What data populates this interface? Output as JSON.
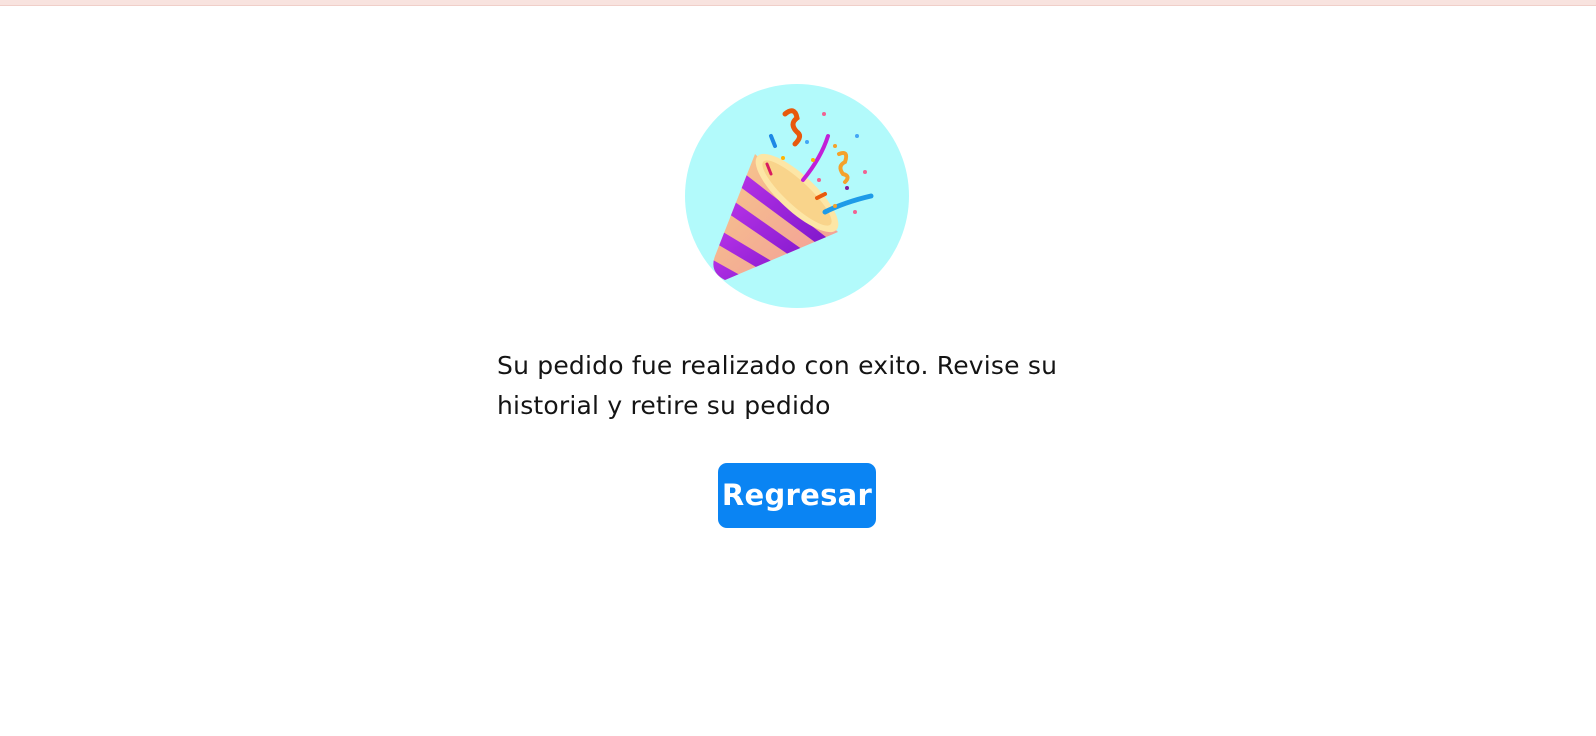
{
  "page": {
    "background": "#ffffff",
    "topbar_color": "#f8e3df"
  },
  "success": {
    "icon": "party-popper-icon",
    "icon_circle_color": "#b2fafb",
    "message_line1": "Su pedido fue realizado con exito. Revise su",
    "message_line2": "historial y retire su pedido",
    "button_label": "Regresar",
    "button_color": "#0a84f3"
  }
}
